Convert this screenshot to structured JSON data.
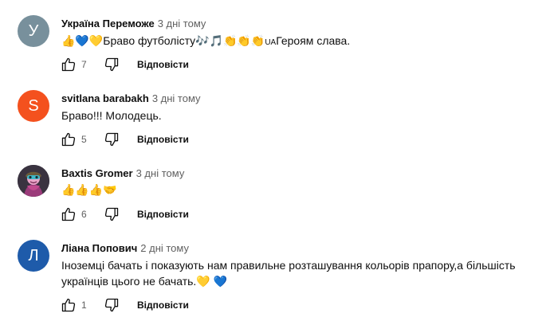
{
  "comments": [
    {
      "avatar_letter": "У",
      "avatar_color": "#78909c",
      "author": "Україна Переможе",
      "time": "3 дні тому",
      "text_parts": [
        "👍💙💛",
        "Браво футболісту",
        "🎶🎵👏👏👏",
        "UA",
        "Героям слава."
      ],
      "likes": "7",
      "reply_label": "Відповісти"
    },
    {
      "avatar_letter": "S",
      "avatar_color": "#f4511e",
      "author": "svitlana barabakh",
      "time": "3 дні тому",
      "text": "Браво!!! Молодець.",
      "likes": "5",
      "reply_label": "Відповісти"
    },
    {
      "avatar_icon": "character-avatar-icon",
      "author": "Baxtis Gromer",
      "time": "3 дні тому",
      "text": "👍👍👍🤝",
      "likes": "6",
      "reply_label": "Відповісти"
    },
    {
      "avatar_letter": "Л",
      "avatar_color": "#1e5baa",
      "author": "Ліана Попович",
      "time": "2 дні тому",
      "text": "Іноземці бачать і показують нам правильне розташування кольорів прапору,а більшість українців цього не бачать.💛 💙",
      "likes": "1",
      "reply_label": "Відповісти"
    }
  ]
}
